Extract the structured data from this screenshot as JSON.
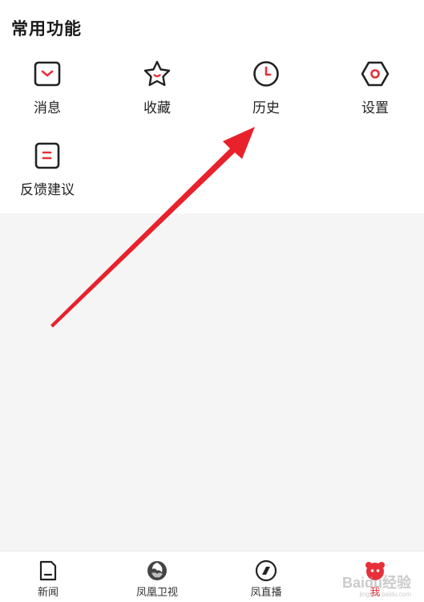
{
  "section": {
    "title": "常用功能"
  },
  "features": [
    {
      "label": "消息",
      "icon": "message-icon"
    },
    {
      "label": "收藏",
      "icon": "star-icon"
    },
    {
      "label": "历史",
      "icon": "clock-icon"
    },
    {
      "label": "设置",
      "icon": "hexagon-settings-icon"
    },
    {
      "label": "反馈建议",
      "icon": "feedback-icon"
    }
  ],
  "tabs": [
    {
      "label": "新闻",
      "icon": "news-icon",
      "active": false
    },
    {
      "label": "凤凰卫视",
      "icon": "phoenix-icon",
      "active": false
    },
    {
      "label": "凤直播",
      "icon": "live-icon",
      "active": false
    },
    {
      "label": "我",
      "icon": "profile-icon",
      "active": true
    }
  ],
  "watermark": {
    "text": "Baidu经验",
    "sub": "jingyan.baidu.com"
  },
  "colors": {
    "accent": "#e8303a",
    "icon_stroke": "#222222",
    "annotation_arrow": "#e8212b"
  }
}
